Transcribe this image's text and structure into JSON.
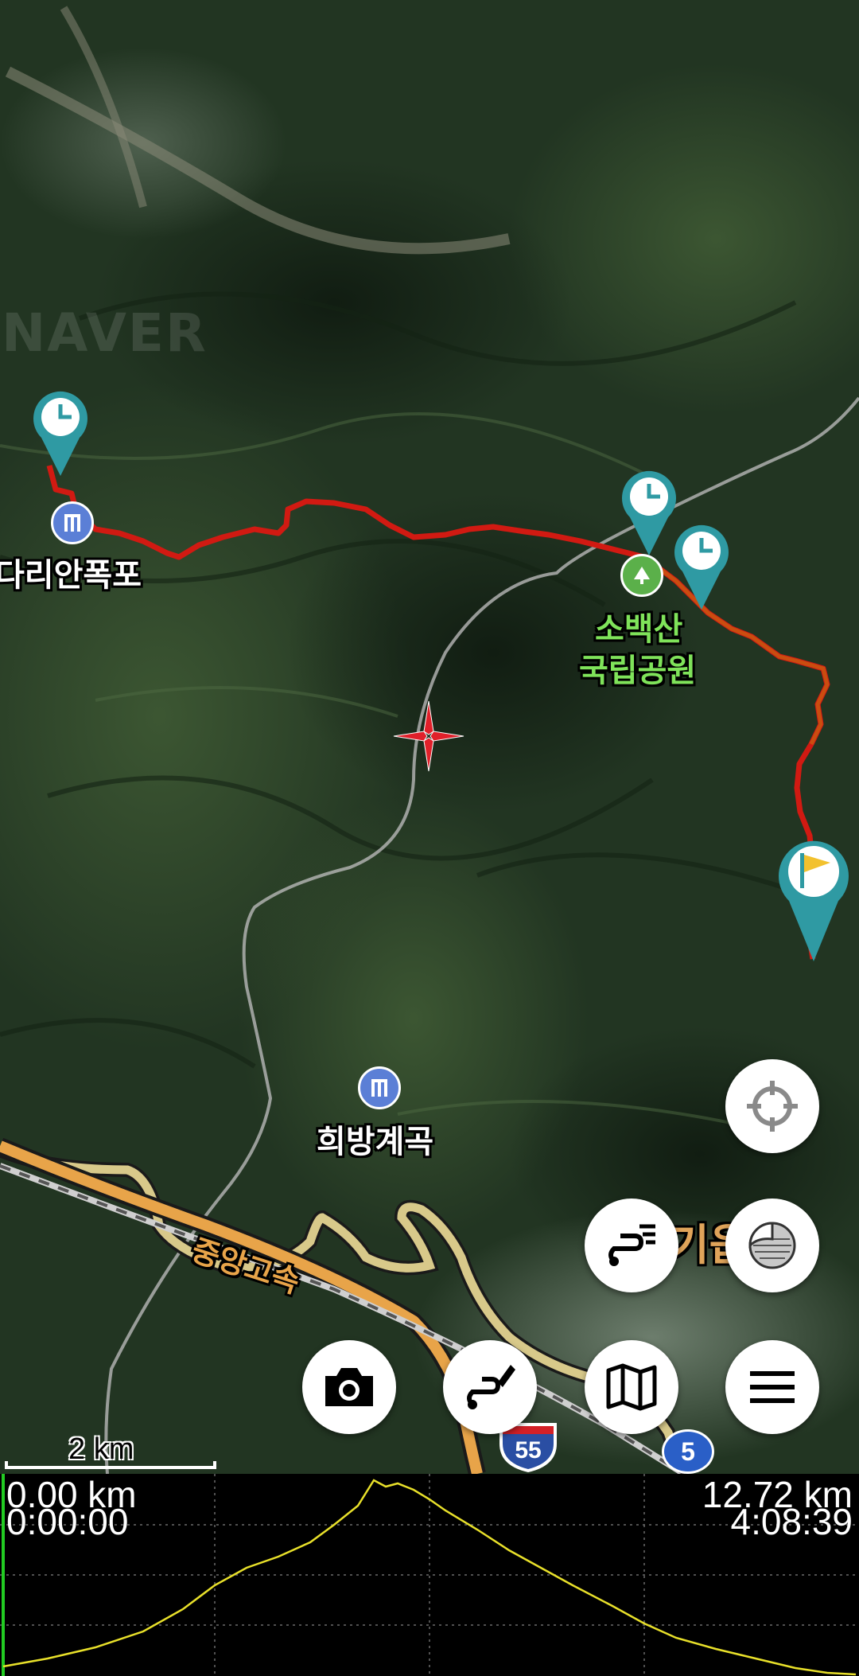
{
  "map": {
    "watermark": "NAVER",
    "labels": {
      "dariyan": "다리안폭포",
      "sobaeksan_line1": "소백산",
      "sobaeksan_line2": "국립공원",
      "huibang": "희방계곡",
      "highway": "중앙고속",
      "town": "기읍"
    },
    "road_shields": {
      "expressway": "55",
      "national": "5"
    },
    "scale_bar": "2 km",
    "markers": [
      "clock-marker",
      "clock-marker",
      "clock-marker",
      "flag-marker"
    ]
  },
  "buttons": {
    "locate": "crosshair-locate",
    "layers": "layers",
    "route_list": "route-list",
    "camera": "camera",
    "draw_route": "draw-route",
    "map_type": "map-type",
    "menu": "menu"
  },
  "profile": {
    "start_distance": "0.00 km",
    "start_time": "0:00:00",
    "end_distance": "12.72 km",
    "end_time": "4:08:39",
    "line_color": "#e8e02a"
  },
  "colors": {
    "track": "#e01a14",
    "marker": "#2f9aa3",
    "poi_blue": "#5b7fd6",
    "poi_green": "#5bb04a"
  }
}
